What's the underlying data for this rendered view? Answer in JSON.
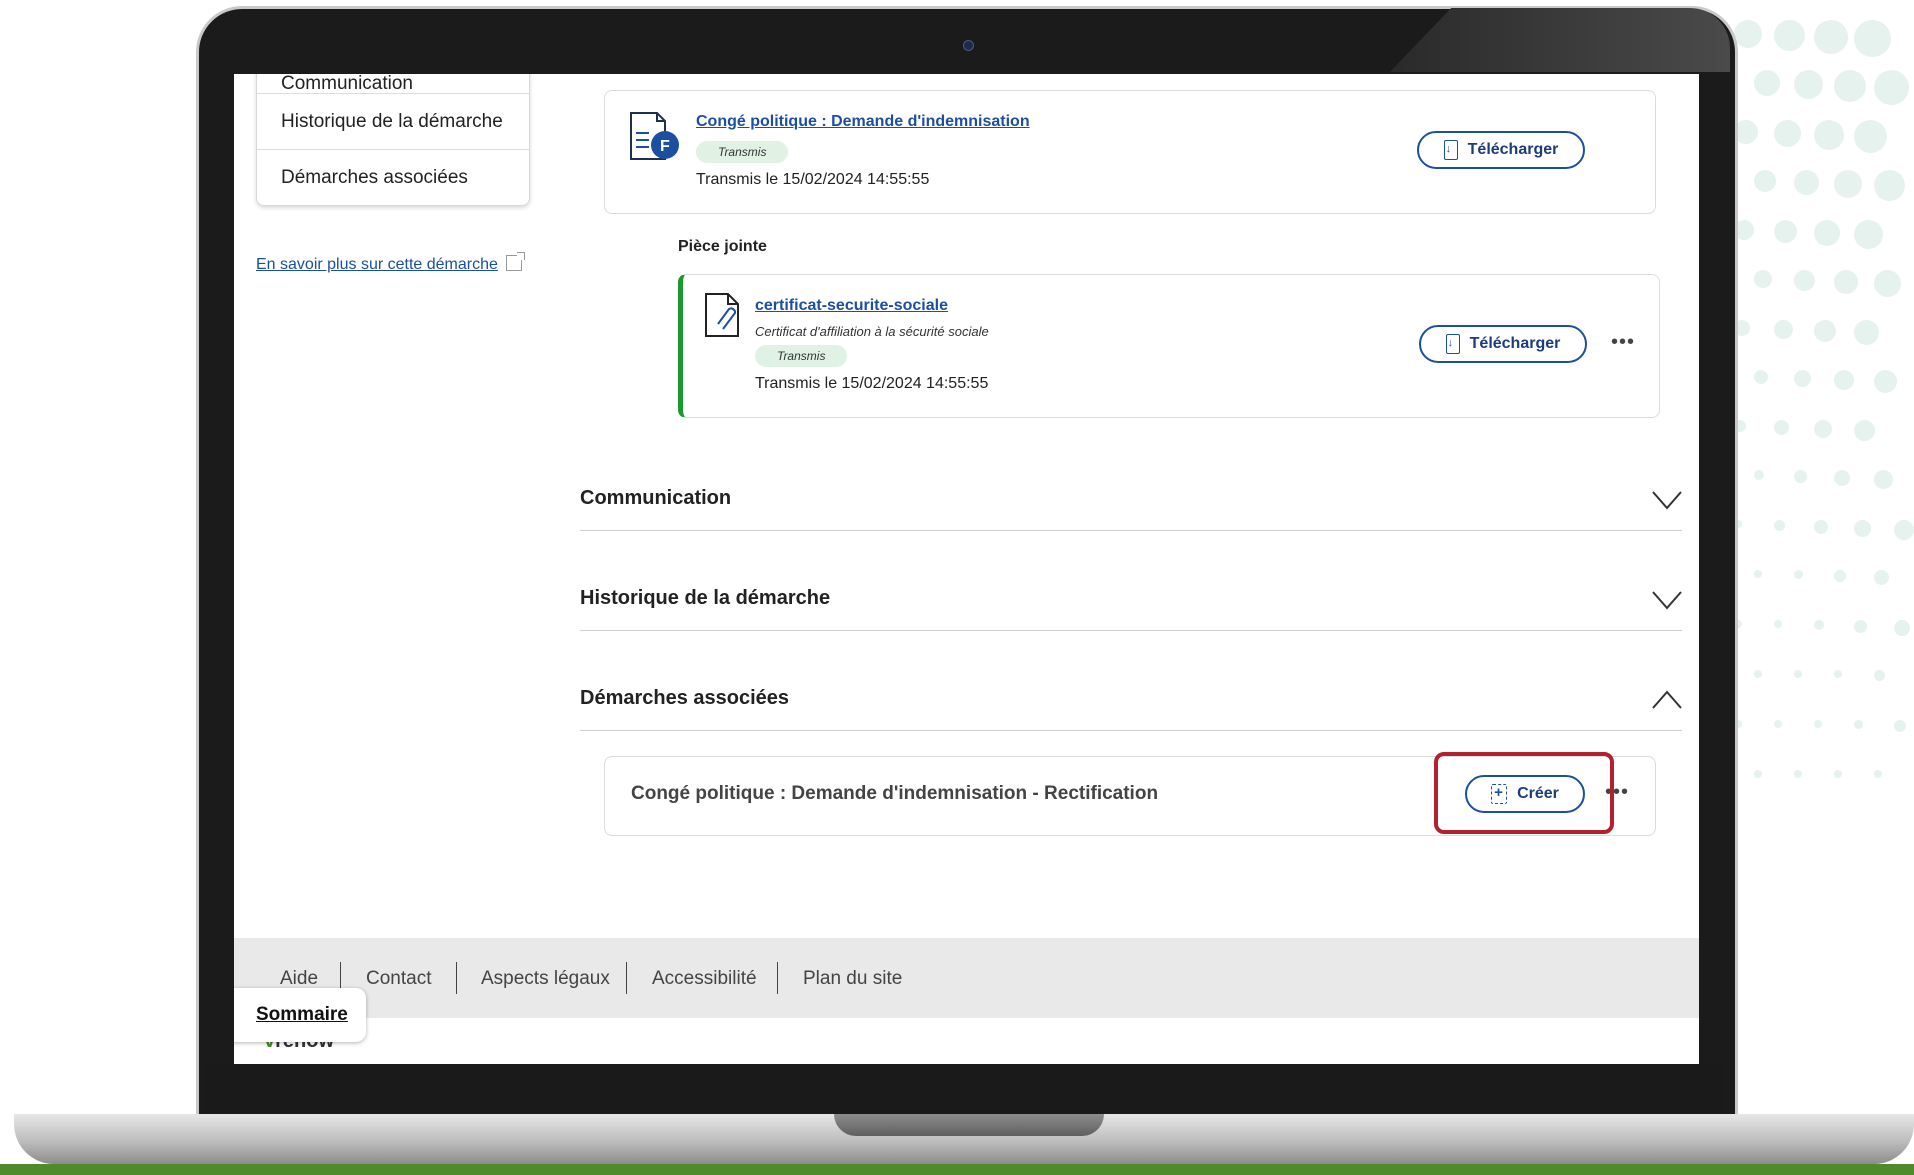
{
  "sidenav": {
    "items": [
      {
        "label": "Communication"
      },
      {
        "label": "Historique de la démarche"
      },
      {
        "label": "Démarches associées"
      }
    ],
    "learn_more": "En savoir plus sur cette démarche"
  },
  "main_document": {
    "title": "Congé politique : Demande d'indemnisation",
    "status": "Transmis",
    "date": "Transmis le 15/02/2024 14:55:55",
    "download_label": "Télécharger"
  },
  "attachment": {
    "section_label": "Pièce jointe",
    "title": "certificat-securite-sociale",
    "description": "Certificat d'affiliation à la sécurité sociale",
    "status": "Transmis",
    "date": "Transmis le 15/02/2024 14:55:55",
    "download_label": "Télécharger",
    "more_label": "•••"
  },
  "accordions": [
    {
      "label": "Communication",
      "expanded": false
    },
    {
      "label": "Historique de la démarche",
      "expanded": false
    },
    {
      "label": "Démarches associées",
      "expanded": true
    }
  ],
  "associated": {
    "title": "Congé politique : Demande d'indemnisation - Rectification",
    "create_label": "Créer",
    "more_label": "•••"
  },
  "footer": {
    "links": [
      "Aide",
      "Contact",
      "Aspects légaux",
      "Accessibilité",
      "Plan du site"
    ],
    "sommaire": "Sommaire",
    "logo_text": "renow"
  },
  "colors": {
    "accent": "#1d4fa1",
    "highlight": "#b3202e",
    "green": "#1a9a2c"
  }
}
